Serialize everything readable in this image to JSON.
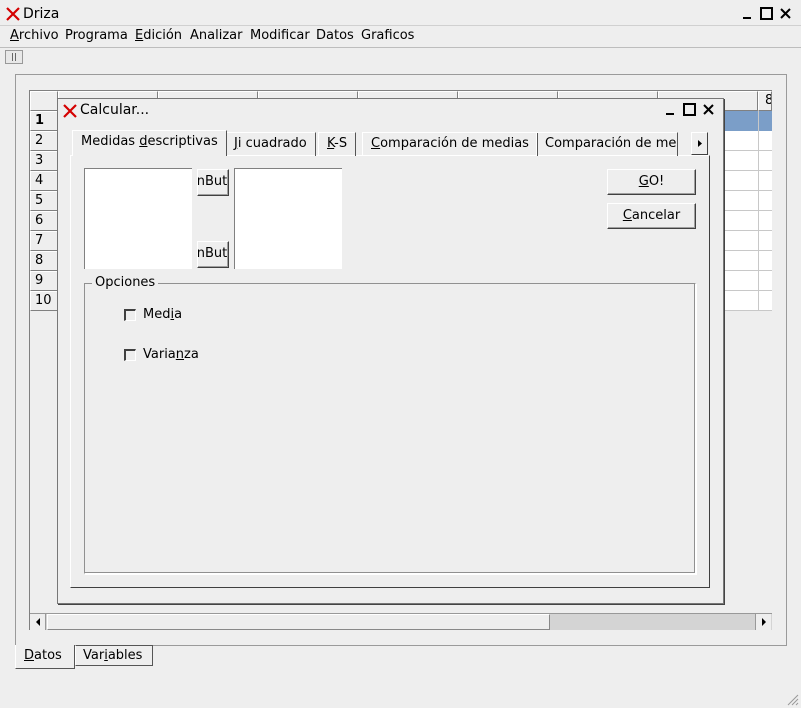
{
  "app": {
    "title": "Driza"
  },
  "menubar": {
    "items": [
      {
        "pre": "",
        "u": "A",
        "post": "rchivo"
      },
      {
        "pre": "Programa",
        "u": "",
        "post": ""
      },
      {
        "pre": "",
        "u": "E",
        "post": "dición"
      },
      {
        "pre": "Analizar",
        "u": "",
        "post": ""
      },
      {
        "pre": "Modificar",
        "u": "",
        "post": ""
      },
      {
        "pre": "Datos",
        "u": "",
        "post": ""
      },
      {
        "pre": "Graficos",
        "u": "",
        "post": ""
      }
    ]
  },
  "grid": {
    "rows": [
      "1",
      "2",
      "3",
      "4",
      "5",
      "6",
      "7",
      "8",
      "9",
      "10"
    ],
    "partial_col_label": "8",
    "selected_row": "1",
    "selection_color": "#7b9ec8"
  },
  "bottom_tabs": {
    "datos": {
      "pre": "",
      "u": "D",
      "post": "atos"
    },
    "variables": {
      "pre": "Var",
      "u": "i",
      "post": "ables"
    }
  },
  "dialog": {
    "title": "Calcular...",
    "tabs": [
      {
        "pre": "Medidas ",
        "u": "d",
        "post": "escriptivas"
      },
      {
        "pre": "",
        "u": "J",
        "post": "i cuadrado"
      },
      {
        "pre": "",
        "u": "K",
        "post": "-S"
      },
      {
        "pre": "",
        "u": "C",
        "post": "omparación de medias"
      },
      {
        "pre": "Comparación de med",
        "u": "",
        "post": ""
      }
    ],
    "transfer_button_1": "nBut",
    "transfer_button_2": "nBut",
    "go_button": {
      "pre": "",
      "u": "G",
      "post": "O!"
    },
    "cancel_button": {
      "pre": "",
      "u": "C",
      "post": "ancelar"
    },
    "options": {
      "legend": "Opciones",
      "media": {
        "pre": "Med",
        "u": "i",
        "post": "a"
      },
      "varianza": {
        "pre": "Varia",
        "u": "n",
        "post": "za"
      }
    }
  },
  "colors": {
    "accent_x": "#d40000",
    "selection": "#7b9ec8",
    "window_bg": "#eeeeee"
  }
}
